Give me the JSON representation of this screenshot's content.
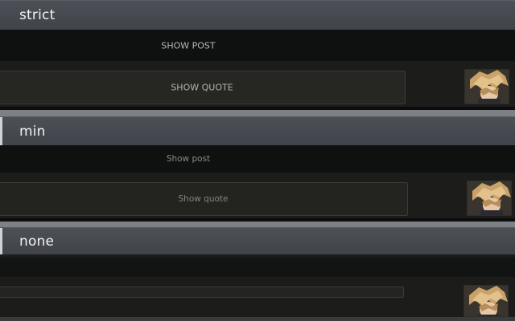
{
  "sections": [
    {
      "title": "strict",
      "show_post_label": "SHOW POST",
      "show_quote_label": "SHOW QUOTE"
    },
    {
      "title": "min",
      "show_post_label": "Show post",
      "show_quote_label": "Show quote"
    },
    {
      "title": "none",
      "show_post_label": "",
      "show_quote_label": ""
    }
  ],
  "avatar_icon": "avatar-icon",
  "colors": {
    "header_bg": "#46494f",
    "row_dark": "#0f1010",
    "row_quote": "#1c1c1b",
    "quote_box": "#262622",
    "quote_border": "#3c3c36",
    "label_text": "#b9b9b3"
  }
}
